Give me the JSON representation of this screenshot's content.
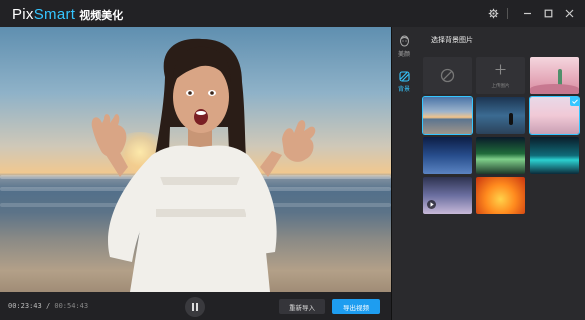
{
  "app": {
    "logo_en_prefix": "Pix",
    "logo_en_suffix": "Smart",
    "logo_cn": "视频美化"
  },
  "titlebar": {
    "icons": [
      "settings-icon",
      "minimize-icon",
      "maximize-icon",
      "close-icon"
    ]
  },
  "player": {
    "current_time": "00:23:43",
    "separator": "/",
    "duration": "00:54:43",
    "reimport_label": "重新导入",
    "export_label": "导出视频"
  },
  "rail": {
    "items": [
      {
        "label": "美颜",
        "icon": "face-beauty-icon",
        "active": false
      },
      {
        "label": "背景",
        "icon": "background-icon",
        "active": true
      }
    ]
  },
  "panel": {
    "title": "选择背景图片",
    "upload_label": "上传图片",
    "tiles": [
      {
        "kind": "none",
        "icon": "none-icon"
      },
      {
        "kind": "upload"
      },
      {
        "kind": "image",
        "scene": "pink-mountains-cactus"
      },
      {
        "kind": "image",
        "scene": "beach-sunset",
        "selected": true
      },
      {
        "kind": "image",
        "scene": "night-road-figure"
      },
      {
        "kind": "image",
        "scene": "pink-snow-landscape",
        "selected": true
      },
      {
        "kind": "image",
        "scene": "blue-night-sky"
      },
      {
        "kind": "image",
        "scene": "aurora-green"
      },
      {
        "kind": "image",
        "scene": "teal-lake-night"
      },
      {
        "kind": "video",
        "scene": "purple-sky-video"
      },
      {
        "kind": "image",
        "scene": "orange-fire"
      }
    ]
  },
  "colors": {
    "accent": "#35c6ff",
    "export_button": "#1e9df0",
    "background": "#1e1e20",
    "panel": "#2a2a2d"
  }
}
